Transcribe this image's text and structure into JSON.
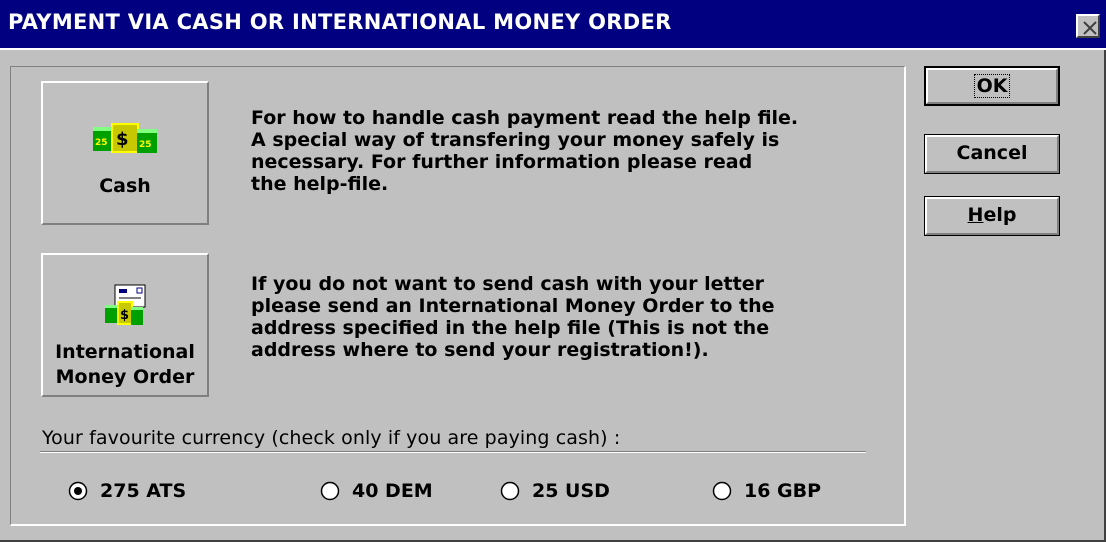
{
  "window": {
    "title": "PAYMENT VIA CASH OR INTERNATIONAL MONEY ORDER"
  },
  "payment_options": [
    {
      "label": "Cash",
      "icon": "cash-icon",
      "description": "For how to handle cash payment read the help file.\nA special way of transfering your money safely is\nnecessary. For further information please read\nthe help-file."
    },
    {
      "label_line1": "International",
      "label_line2": "Money Order",
      "icon": "money-order-icon",
      "description": "If you do not want to send cash with your letter\nplease send an International Money Order to the\naddress specified in the help file (This is not the\naddress where to send your registration!)."
    }
  ],
  "currency": {
    "label": "Your favourite currency (check only if you are paying cash) :",
    "options": [
      "275 ATS",
      "40 DEM",
      "25 USD",
      "16 GBP"
    ],
    "selected": "275 ATS"
  },
  "buttons": {
    "ok": "OK",
    "cancel": "Cancel",
    "help_mnemonic": "H",
    "help_rest": "elp"
  },
  "colors": {
    "title_bar": "#000080",
    "face": "#c0c0c0",
    "money_green": "#00a000",
    "money_yellow": "#ffff00"
  }
}
